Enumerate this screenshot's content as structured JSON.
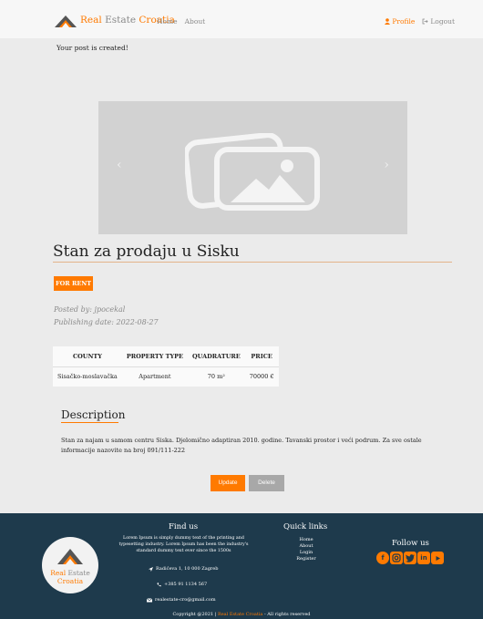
{
  "navbar": {
    "brand_part1": "Real ",
    "brand_part2": "Estate ",
    "brand_part3": "Croatia",
    "links": [
      "Home",
      "About"
    ],
    "profile_label": "Profile",
    "logout_label": "Logout"
  },
  "flash_message": "Your post is created!",
  "carousel": {
    "prev_label": "‹",
    "next_label": "›"
  },
  "listing": {
    "title": "Stan za prodaju u Sisku",
    "badge": "FOR RENT",
    "posted_by": "Posted by: jpocekal",
    "publishing_date": "Publishing date: 2022-08-27"
  },
  "specs_table": {
    "headers": [
      "COUNTY",
      "PROPERTY TYPE",
      "QUADRATURE",
      "PRICE"
    ],
    "row": [
      "Sisačko-moslavačka",
      "Apartment",
      "70 m²",
      "70000 €"
    ]
  },
  "description": {
    "title": "Description",
    "text": "Stan za najam u samom centru Siska. Djelomično adaptiran 2010. godine. Tavanski prostor i veći podrum. Za sve ostale informacije nazovite na broj 091/111-222"
  },
  "actions": {
    "update_label": "Update",
    "delete_label": "Delete"
  },
  "footer": {
    "logo_line1a": "Real ",
    "logo_line1b": "Estate",
    "logo_line2": "Croatia",
    "find_us_title": "Find us",
    "find_us_text": "Lorem Ipsum is simply dummy text of the printing and typesetting industry. Lorem Ipsum has been the industry's standard dummy text ever since the 1500s",
    "address": "Radićeva 1, 10 000 Zagreb",
    "phone": "+385 91 1134 567",
    "email": "realestate-cro@gmail.com",
    "quick_links_title": "Quick links",
    "quick_links": [
      "Home",
      "About",
      "Login",
      "Register"
    ],
    "follow_title": "Follow us",
    "social_icons": [
      "facebook-icon",
      "instagram-icon",
      "twitter-icon",
      "linkedin-icon",
      "youtube-icon"
    ],
    "copyright_prefix": "Copyright @2021 | ",
    "copyright_brand": "Real Estate Croatia",
    "copyright_suffix": " - All rights reserved"
  },
  "colors": {
    "accent": "#ff7a00",
    "footer_bg": "#1e3a4c",
    "page_bg": "#ebebeb",
    "muted": "#8a8a8a"
  }
}
